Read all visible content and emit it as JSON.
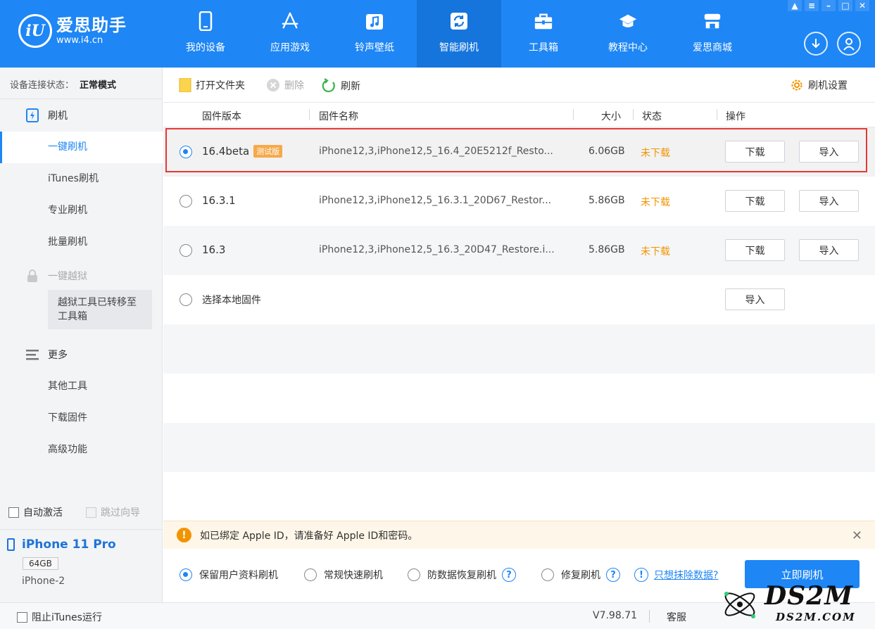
{
  "app": {
    "logo_name": "爱思助手",
    "logo_url": "www.i4.cn",
    "logo_mark": "iU"
  },
  "nav": [
    {
      "label": "我的设备",
      "icon": "phone-icon"
    },
    {
      "label": "应用游戏",
      "icon": "app-store-icon"
    },
    {
      "label": "铃声壁纸",
      "icon": "music-icon"
    },
    {
      "label": "智能刷机",
      "icon": "refresh-icon",
      "active": true
    },
    {
      "label": "工具箱",
      "icon": "toolbox-icon"
    },
    {
      "label": "教程中心",
      "icon": "graduation-cap-icon"
    },
    {
      "label": "爱思商城",
      "icon": "shop-icon"
    }
  ],
  "sidebar": {
    "conn_label": "设备连接状态：",
    "conn_value": "正常模式",
    "flash_group": "刷机",
    "items": [
      "一键刷机",
      "iTunes刷机",
      "专业刷机",
      "批量刷机"
    ],
    "jailbreak_group": "一键越狱",
    "jailbreak_note": "越狱工具已转移至工具箱",
    "more_group": "更多",
    "more_items": [
      "其他工具",
      "下载固件",
      "高级功能"
    ],
    "auto_activate": "自动激活",
    "skip_guide": "跳过向导"
  },
  "device": {
    "name": "iPhone 11 Pro",
    "capacity": "64GB",
    "model": "iPhone-2"
  },
  "toolbar": {
    "open_folder": "打开文件夹",
    "delete": "删除",
    "refresh": "刷新",
    "settings": "刷机设置"
  },
  "table": {
    "headers": {
      "version": "固件版本",
      "name": "固件名称",
      "size": "大小",
      "status": "状态",
      "ops": "操作"
    },
    "rows": [
      {
        "version": "16.4beta",
        "badge": "测试版",
        "name": "iPhone12,3,iPhone12,5_16.4_20E5212f_Resto...",
        "size": "6.06GB",
        "status": "未下载",
        "download": "下载",
        "import": "导入"
      },
      {
        "version": "16.3.1",
        "name": "iPhone12,3,iPhone12,5_16.3.1_20D67_Restor...",
        "size": "5.86GB",
        "status": "未下载",
        "download": "下载",
        "import": "导入"
      },
      {
        "version": "16.3",
        "name": "iPhone12,3,iPhone12,5_16.3_20D47_Restore.i...",
        "size": "5.86GB",
        "status": "未下载",
        "download": "下载",
        "import": "导入"
      }
    ],
    "local_label": "选择本地固件",
    "local_import": "导入"
  },
  "notice": {
    "text": "如已绑定 Apple ID，请准备好 Apple ID和密码。"
  },
  "modes": {
    "keep_data": "保留用户资料刷机",
    "quick": "常规快速刷机",
    "anti_recovery": "防数据恢复刷机",
    "repair": "修复刷机",
    "wipe_link": "只想抹除数据?",
    "flash_now": "立即刷机"
  },
  "statusbar": {
    "block_itunes": "阻止iTunes运行",
    "version": "V7.98.71",
    "support": "客服"
  },
  "watermark": {
    "brand": "DS2M",
    "site": "DS2M.COM"
  },
  "colors": {
    "brand_blue": "#1e86f5",
    "status_orange": "#f29400",
    "highlight_red": "#e53935"
  }
}
